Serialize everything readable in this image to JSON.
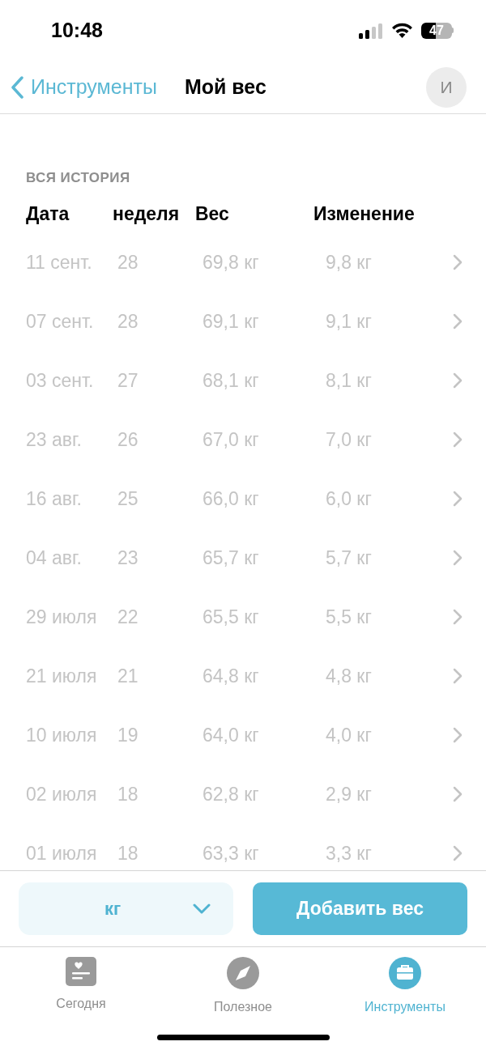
{
  "status_bar": {
    "time": "10:48",
    "battery": "47"
  },
  "nav": {
    "back": "Инструменты",
    "title": "Мой вес",
    "avatar": "И"
  },
  "history": {
    "section": "ВСЯ ИСТОРИЯ",
    "columns": [
      "Дата",
      "неделя",
      "Вес",
      "Изменение"
    ],
    "rows": [
      {
        "date": "11 сент.",
        "week": "28",
        "weight": "69,8 кг",
        "change": "9,8 кг"
      },
      {
        "date": "07 сент.",
        "week": "28",
        "weight": "69,1 кг",
        "change": "9,1 кг"
      },
      {
        "date": "03 сент.",
        "week": "27",
        "weight": "68,1 кг",
        "change": "8,1 кг"
      },
      {
        "date": "23 авг.",
        "week": "26",
        "weight": "67,0 кг",
        "change": "7,0 кг"
      },
      {
        "date": "16 авг.",
        "week": "25",
        "weight": "66,0 кг",
        "change": "6,0 кг"
      },
      {
        "date": "04 авг.",
        "week": "23",
        "weight": "65,7 кг",
        "change": "5,7 кг"
      },
      {
        "date": "29 июля",
        "week": "22",
        "weight": "65,5 кг",
        "change": "5,5 кг"
      },
      {
        "date": "21 июля",
        "week": "21",
        "weight": "64,8 кг",
        "change": "4,8 кг"
      },
      {
        "date": "10 июля",
        "week": "19",
        "weight": "64,0 кг",
        "change": "4,0 кг"
      },
      {
        "date": "02 июля",
        "week": "18",
        "weight": "62,8 кг",
        "change": "2,9 кг"
      },
      {
        "date": "01 июля",
        "week": "18",
        "weight": "63,3 кг",
        "change": "3,3 кг"
      }
    ]
  },
  "unit_select": {
    "value": "кг"
  },
  "add_button": "Добавить вес",
  "tabs": [
    {
      "label": "Сегодня",
      "kind": "card",
      "selected": false
    },
    {
      "label": "Полезное",
      "kind": "compass",
      "selected": false
    },
    {
      "label": "Инструменты",
      "kind": "briefcase",
      "selected": true
    }
  ]
}
